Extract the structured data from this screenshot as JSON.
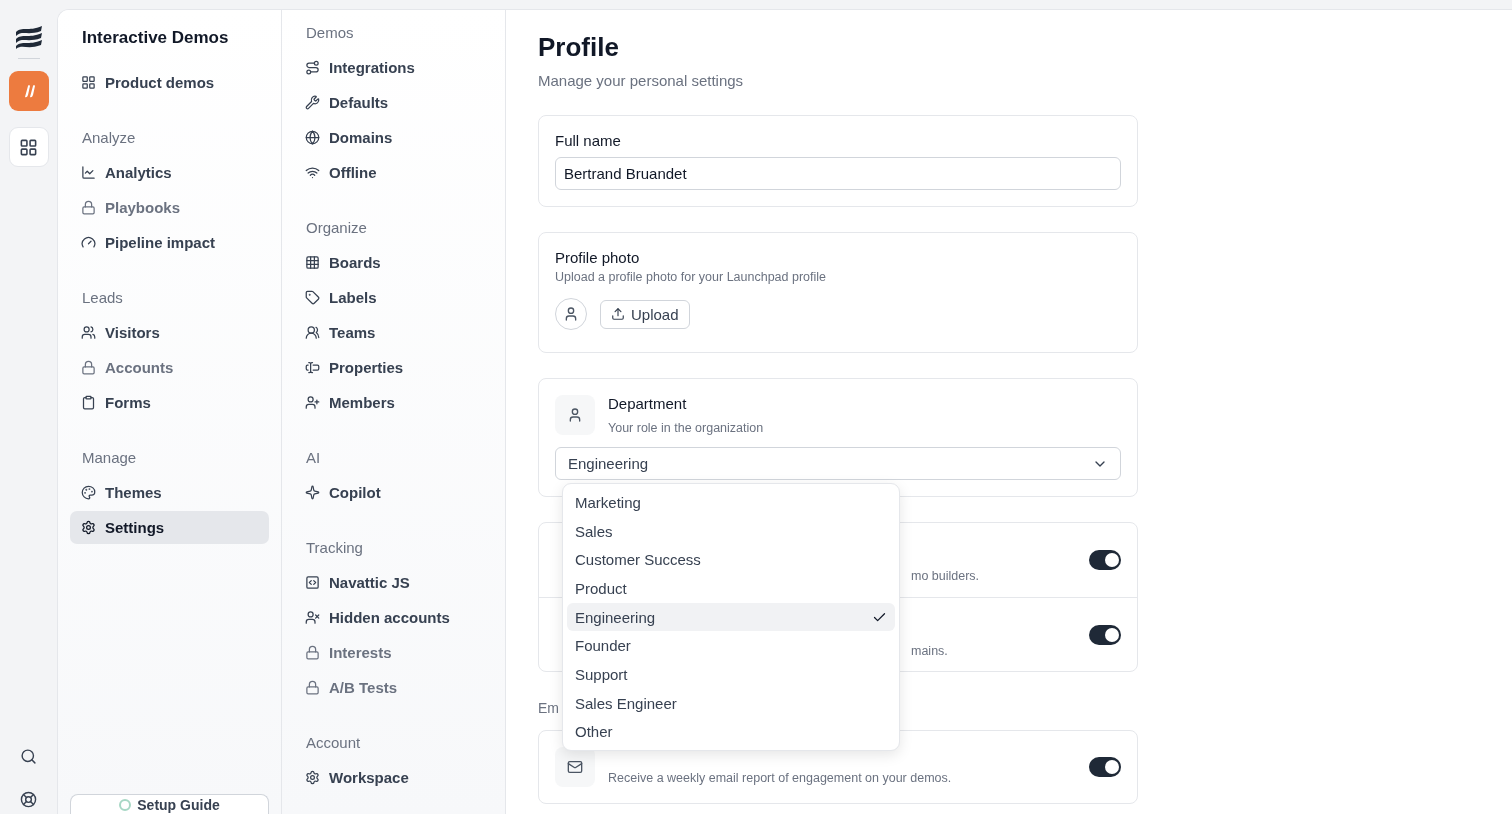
{
  "sidebar": {
    "title": "Interactive Demos",
    "top_item": {
      "label": "Product demos",
      "selected": false
    },
    "sections": [
      {
        "heading": "Analyze",
        "items": [
          {
            "label": "Analytics",
            "locked": false,
            "selected": false
          },
          {
            "label": "Playbooks",
            "locked": true,
            "selected": false
          },
          {
            "label": "Pipeline impact",
            "locked": false,
            "selected": false
          }
        ]
      },
      {
        "heading": "Leads",
        "items": [
          {
            "label": "Visitors",
            "locked": false,
            "selected": false
          },
          {
            "label": "Accounts",
            "locked": true,
            "selected": false
          },
          {
            "label": "Forms",
            "locked": false,
            "selected": false
          }
        ]
      },
      {
        "heading": "Manage",
        "items": [
          {
            "label": "Themes",
            "locked": false,
            "selected": false
          },
          {
            "label": "Settings",
            "locked": false,
            "selected": true
          }
        ]
      }
    ],
    "setup_button": "Setup Guide"
  },
  "settings_nav": {
    "sections": [
      {
        "heading": "Demos",
        "items": [
          {
            "label": "Integrations",
            "locked": false
          },
          {
            "label": "Defaults",
            "locked": false
          },
          {
            "label": "Domains",
            "locked": false
          },
          {
            "label": "Offline",
            "locked": false
          }
        ]
      },
      {
        "heading": "Organize",
        "items": [
          {
            "label": "Boards",
            "locked": false
          },
          {
            "label": "Labels",
            "locked": false
          },
          {
            "label": "Teams",
            "locked": false
          },
          {
            "label": "Properties",
            "locked": false
          },
          {
            "label": "Members",
            "locked": false
          }
        ]
      },
      {
        "heading": "AI",
        "items": [
          {
            "label": "Copilot",
            "locked": false
          }
        ]
      },
      {
        "heading": "Tracking",
        "items": [
          {
            "label": "Navattic JS",
            "locked": false
          },
          {
            "label": "Hidden accounts",
            "locked": false
          },
          {
            "label": "Interests",
            "locked": true
          },
          {
            "label": "A/B Tests",
            "locked": true
          }
        ]
      },
      {
        "heading": "Account",
        "items": [
          {
            "label": "Workspace",
            "locked": false
          }
        ]
      }
    ]
  },
  "page": {
    "title": "Profile",
    "subtitle": "Manage your personal settings",
    "full_name": {
      "label": "Full name",
      "value": "Bertrand Bruandet"
    },
    "photo": {
      "label": "Profile photo",
      "hint": "Upload a profile photo for your Launchpad profile",
      "button": "Upload"
    },
    "department": {
      "label": "Department",
      "hint": "Your role in the organization",
      "value": "Engineering",
      "options": [
        {
          "label": "Marketing",
          "selected": false
        },
        {
          "label": "Sales",
          "selected": false
        },
        {
          "label": "Customer Success",
          "selected": false
        },
        {
          "label": "Product",
          "selected": false
        },
        {
          "label": "Engineering",
          "selected": true
        },
        {
          "label": "Founder",
          "selected": false
        },
        {
          "label": "Support",
          "selected": false
        },
        {
          "label": "Sales Engineer",
          "selected": false
        },
        {
          "label": "Other",
          "selected": false
        }
      ]
    },
    "toggles": [
      {
        "description": "mo builders.",
        "on": true
      },
      {
        "description": "mains.",
        "on": true
      }
    ],
    "email_heading": "Em",
    "email_toggle": {
      "description": "Receive a weekly email report of engagement on your demos.",
      "on": true
    }
  }
}
